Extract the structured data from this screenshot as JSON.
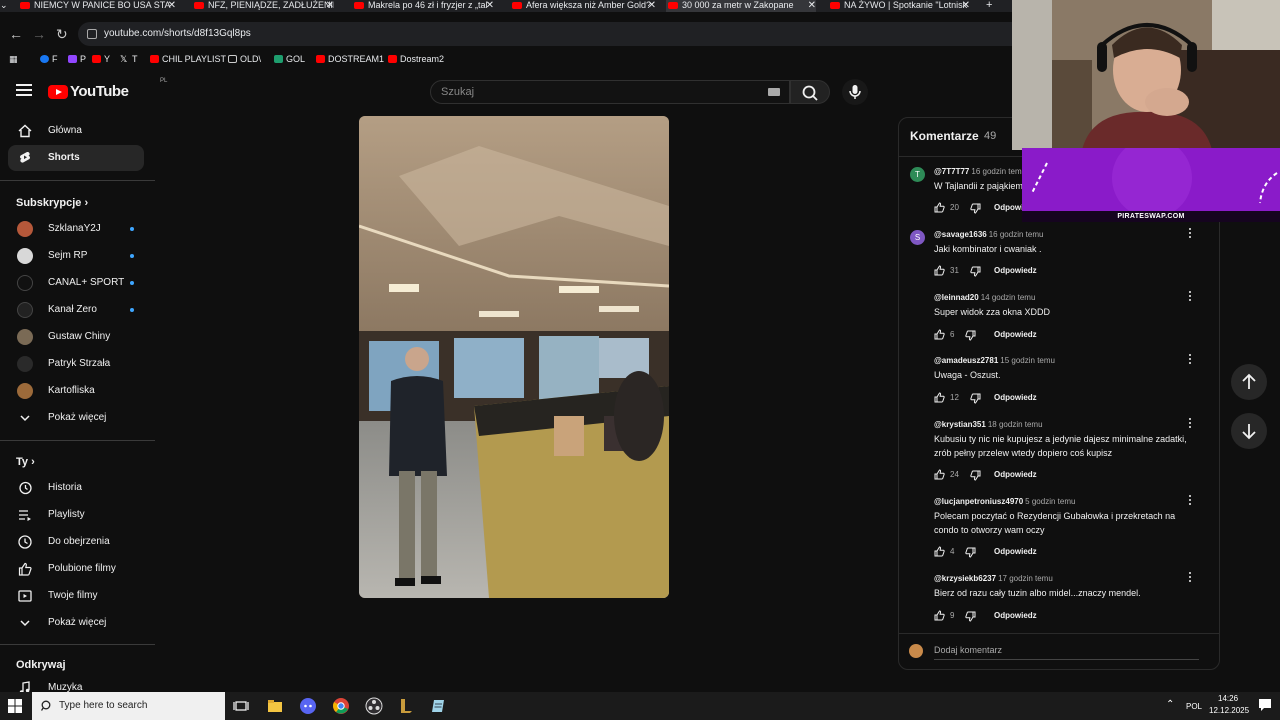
{
  "browser": {
    "tabs": [
      {
        "title": "NIEMCY W PANICE BO USA STA",
        "close": "✕"
      },
      {
        "title": "NFZ, PIENIĄDZE, ZADŁUŻENIE S",
        "close": "✕"
      },
      {
        "title": "Makrela po 46 zł i fryzjer z „tal",
        "close": "✕"
      },
      {
        "title": "Afera większa niż Amber Gold?",
        "close": "✕"
      },
      {
        "title": "30 000 za metr w Zakopane",
        "close": "✕"
      },
      {
        "title": "NA ŻYWO | Spotkanie \"Lotnisk",
        "close": "✕"
      }
    ],
    "new_tab": "+",
    "url": "youtube.com/shorts/d8f13Gql8ps",
    "bookmarks": [
      "F",
      "P",
      "Y",
      "T",
      "CHIL PLAYLIST",
      "OLD\\",
      "GOL",
      "DOSTREAM1",
      "Dostream2"
    ]
  },
  "youtube": {
    "logo_text": "YouTube",
    "logo_region": "PL",
    "search_placeholder": "Szukaj"
  },
  "sidebar": {
    "main": [
      {
        "label": "Główna",
        "active": false
      },
      {
        "label": "Shorts",
        "active": true
      }
    ],
    "subs_heading": "Subskrypcje",
    "subs": [
      {
        "label": "SzklanaY2J",
        "live": true,
        "color": "#b5583a"
      },
      {
        "label": "Sejm RP",
        "live": true,
        "color": "#d8d8d8"
      },
      {
        "label": "CANAL+ SPORT",
        "live": true,
        "color": "#111111"
      },
      {
        "label": "Kanał Zero",
        "live": true,
        "color": "#222222"
      },
      {
        "label": "Gustaw Chiny",
        "live": false,
        "color": "#7a6a55"
      },
      {
        "label": "Patryk Strzała",
        "live": false,
        "color": "#2a2a2a"
      },
      {
        "label": "Kartofliska",
        "live": false,
        "color": "#9c6a3a"
      }
    ],
    "subs_more": "Pokaż więcej",
    "you_heading": "Ty",
    "you": [
      {
        "label": "Historia",
        "icon": "history-icon"
      },
      {
        "label": "Playlisty",
        "icon": "playlist-icon"
      },
      {
        "label": "Do obejrzenia",
        "icon": "watch-later-icon"
      },
      {
        "label": "Polubione filmy",
        "icon": "thumb-up-icon"
      },
      {
        "label": "Twoje filmy",
        "icon": "video-icon"
      }
    ],
    "you_more": "Pokaż więcej",
    "explore_heading": "Odkrywaj",
    "explore": [
      {
        "label": "Muzyka",
        "icon": "music-icon"
      }
    ]
  },
  "comments": {
    "title": "Komentarze",
    "count": "49",
    "reply_label": "Odpowiedz",
    "add_placeholder": "Dodaj komentarz",
    "items": [
      {
        "author": "@7T7T77",
        "time": "16 godzin temu",
        "lines": [
          "W Tajlandii z pająkiem"
        ],
        "likes": "20",
        "avatar_letter": "T",
        "avatar_color": "#2e8b57"
      },
      {
        "author": "@savage1636",
        "time": "16 godzin temu",
        "lines": [
          "Jaki kombinator i cwaniak ."
        ],
        "likes": "31",
        "avatar_letter": "S",
        "avatar_color": "#7e57c2"
      },
      {
        "author": "@leinnad20",
        "time": "14 godzin temu",
        "lines": [
          "Super widok zza okna XDDD"
        ],
        "likes": "6",
        "avatar_letter": "",
        "avatar_color": ""
      },
      {
        "author": "@amadeusz2781",
        "time": "15 godzin temu",
        "lines": [
          "Uwaga - Oszust."
        ],
        "likes": "12",
        "avatar_letter": "",
        "avatar_color": ""
      },
      {
        "author": "@krystian351",
        "time": "18 godzin temu",
        "lines": [
          "Kubusiu ty nic nie kupujesz a jedynie dajesz minimalne zadatki,",
          "zrób pełny przelew wtedy dopiero coś kupisz"
        ],
        "likes": "24",
        "avatar_letter": "",
        "avatar_color": ""
      },
      {
        "author": "@lucjanpetroniusz4970",
        "time": "5 godzin temu",
        "lines": [
          "Polecam poczytać o Rezydencji Gubałowka i przekretach na",
          "condo to otworzy wam oczy"
        ],
        "likes": "4",
        "avatar_letter": "",
        "avatar_color": ""
      },
      {
        "author": "@krzysiekb6237",
        "time": "17 godzin temu",
        "lines": [
          "Bierz od razu cały tuzin albo midel...znaczy mendel."
        ],
        "likes": "9",
        "avatar_letter": "",
        "avatar_color": ""
      }
    ]
  },
  "overlay": {
    "ad_text": "PIRATESWAP.COM"
  },
  "taskbar": {
    "search_placeholder": "Type here to search",
    "lang": "POL",
    "time": "14:26",
    "date": "12.12.2025"
  }
}
